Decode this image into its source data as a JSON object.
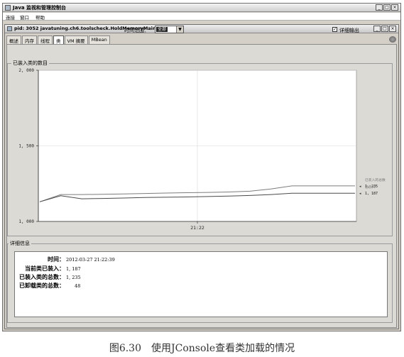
{
  "window": {
    "title": "Java 监视和管理控制台",
    "controls": [
      "_",
      "□",
      "×"
    ]
  },
  "menu": [
    "连接",
    "窗口",
    "帮助"
  ],
  "inner_window": {
    "title": "pid: 3052 javatuning.ch6.toolscheck.HoldMemoryMain",
    "controls": [
      "_",
      "□",
      "×"
    ]
  },
  "tabs": [
    {
      "label": "概述",
      "active": false
    },
    {
      "label": "内存",
      "active": false
    },
    {
      "label": "线程",
      "active": false
    },
    {
      "label": "类",
      "active": true
    },
    {
      "label": "VM 摘要",
      "active": false
    },
    {
      "label": "MBean",
      "active": false
    }
  ],
  "toolbar": {
    "time_range_label": "时间范围：",
    "time_range_value": "全部",
    "verbose_label": "详细输出",
    "verbose_checked": true,
    "verbose_mark": "✓"
  },
  "chart_panel_title": "已装入类的数目",
  "chart_data": {
    "type": "line",
    "x_ticks": [
      "21:22"
    ],
    "y_ticks": [
      "2, 000",
      "1, 500",
      "1, 000"
    ],
    "ylim": [
      1000,
      2000
    ],
    "series": [
      {
        "name": "已装入的总数",
        "latest_label": "1, 235",
        "color": "#7c7c7c",
        "values": [
          1130,
          1178,
          1178,
          1180,
          1182,
          1185,
          1188,
          1190,
          1192,
          1195,
          1200,
          1215,
          1235,
          1235,
          1235,
          1235
        ]
      },
      {
        "name": "已装入",
        "latest_label": "1, 187",
        "color": "#4a4a4a",
        "values": [
          1130,
          1170,
          1150,
          1152,
          1155,
          1158,
          1160,
          1162,
          1165,
          1168,
          1172,
          1178,
          1187,
          1187,
          1187,
          1187
        ]
      }
    ]
  },
  "details": {
    "panel_title": "详细信息",
    "rows": [
      {
        "label": "时间：",
        "value": "2012-03-27 21:22:39"
      },
      {
        "label": "当前类已装入：",
        "value": "1, 187"
      },
      {
        "label": "已装入类的总数：",
        "value": "1, 235"
      },
      {
        "label": "已卸载类的总数：",
        "value": "48"
      }
    ]
  },
  "caption": "图6.30　使用JConsole查看类加载的情况"
}
